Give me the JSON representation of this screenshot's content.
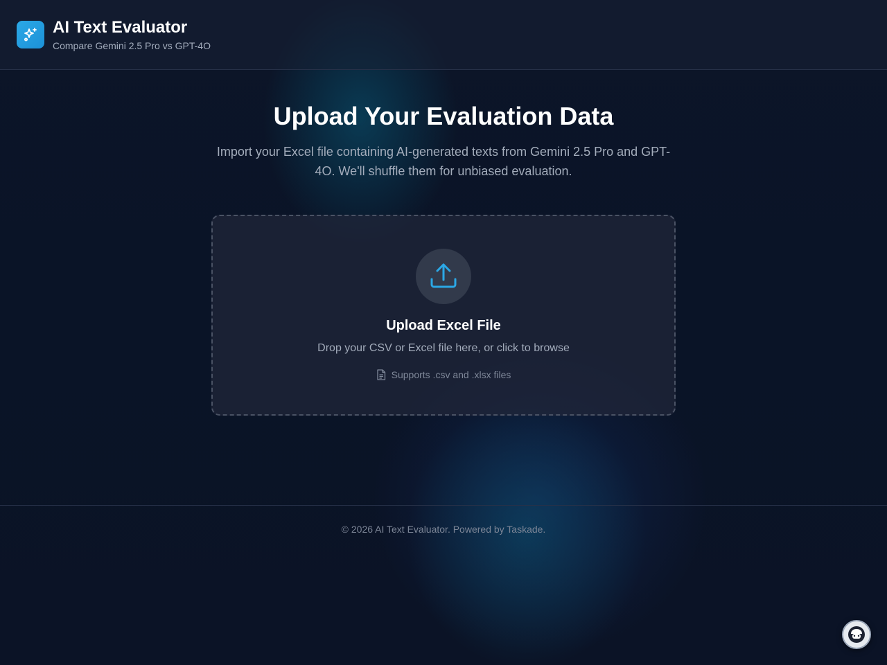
{
  "header": {
    "title": "AI Text Evaluator",
    "subtitle": "Compare Gemini 2.5 Pro vs GPT-4O",
    "logo_icon": "sparkles-icon",
    "logo_color": "#2ba8e6"
  },
  "main": {
    "title": "Upload Your Evaluation Data",
    "description": "Import your Excel file containing AI-generated texts from Gemini 2.5 Pro and GPT-4O. We'll shuffle them for unbiased evaluation."
  },
  "upload": {
    "icon": "upload-icon",
    "title": "Upload Excel File",
    "hint": "Drop your CSV or Excel file here, or click to browse",
    "supports_icon": "file-text-icon",
    "supports": "Supports .csv and .xlsx files",
    "accent_color": "#2ba8e6"
  },
  "footer": {
    "copyright": "© 2026 AI Text Evaluator. Powered by Taskade."
  },
  "chat_widget": {
    "icon": "chat-avatar-icon"
  }
}
